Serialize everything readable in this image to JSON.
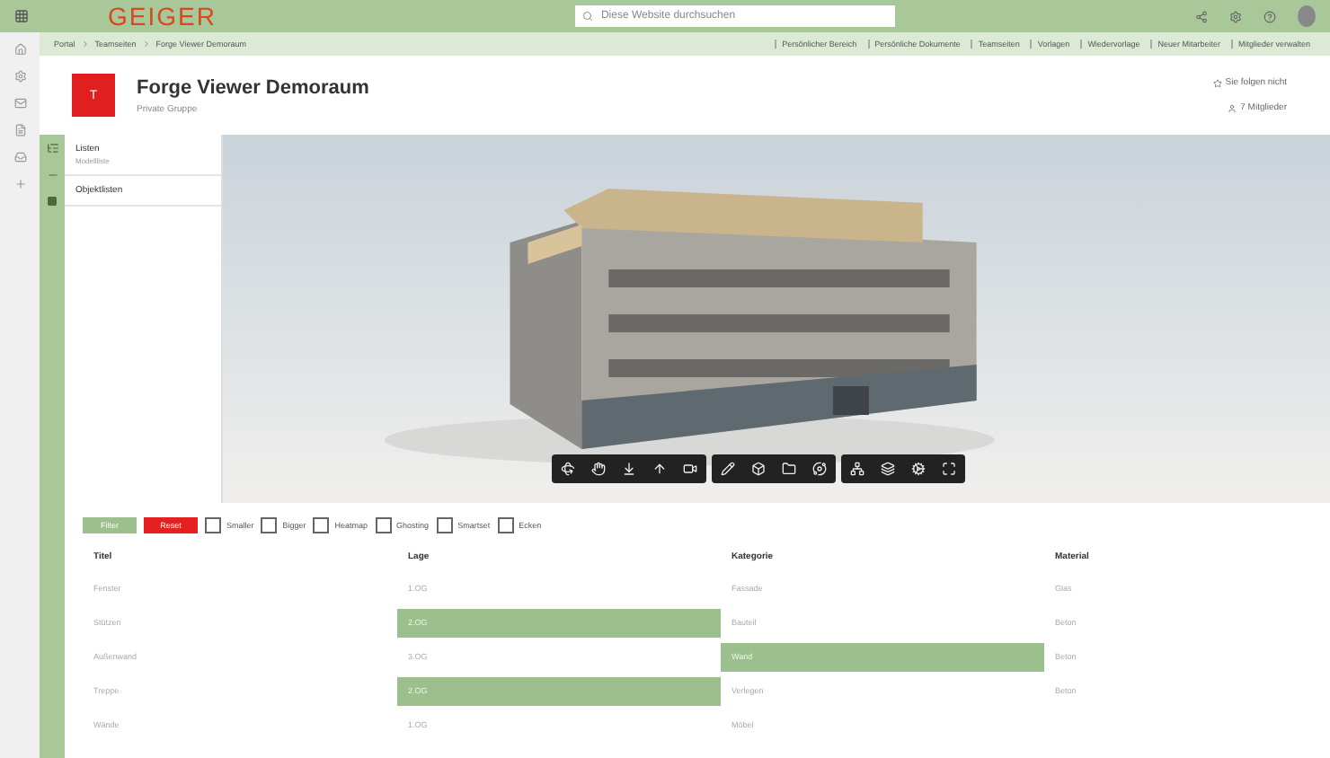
{
  "topbar": {
    "logo": "GEIGER",
    "search": {
      "placeholder": "Diese Website durchsuchen"
    }
  },
  "breadcrumb": [
    "Portal",
    "Teamseiten",
    "Forge Viewer Demoraum"
  ],
  "nav_links": [
    "Persönlicher Bereich",
    "Persönliche Dokumente",
    "Teamseiten",
    "Vorlagen",
    "Wiedervorlage",
    "Neuer Mitarbeiter",
    "Mitglieder verwalten"
  ],
  "site": {
    "badge": "T",
    "title": "Forge Viewer Demoraum",
    "subtitle": "Private Gruppe",
    "follow": "Sie folgen nicht",
    "members": "7 Mitglieder"
  },
  "side_panel": [
    {
      "label": "Listen",
      "sub": "Modellliste"
    },
    {
      "label": "Objektlisten"
    }
  ],
  "filter": {
    "buttons": [
      {
        "label": "Filter",
        "kind": "primary"
      },
      {
        "label": "Reset",
        "kind": "danger"
      }
    ],
    "options": [
      {
        "label": "Smaller",
        "checked": false
      },
      {
        "label": "Bigger",
        "checked": false
      },
      {
        "label": "Heatmap",
        "checked": false
      },
      {
        "label": "Ghosting",
        "checked": false
      },
      {
        "label": "Smartset",
        "checked": false
      },
      {
        "label": "Ecken",
        "checked": false
      }
    ]
  },
  "table": {
    "columns": [
      "Titel",
      "Lage",
      "Kategorie",
      "Material"
    ],
    "rows": [
      [
        {
          "text": "Fenster",
          "highlighted": false
        },
        {
          "text": "1.OG",
          "highlighted": false
        },
        {
          "text": "Fassade",
          "highlighted": false
        },
        {
          "text": "Glas",
          "highlighted": false
        }
      ],
      [
        {
          "text": "Stützen",
          "highlighted": false
        },
        {
          "text": "2.OG",
          "highlighted": true
        },
        {
          "text": "Bauteil",
          "highlighted": false
        },
        {
          "text": "Beton",
          "highlighted": false
        }
      ],
      [
        {
          "text": "Außenwand",
          "highlighted": false
        },
        {
          "text": "3.OG",
          "highlighted": false
        },
        {
          "text": "Wand",
          "highlighted": true
        },
        {
          "text": "Beton",
          "highlighted": false
        }
      ],
      [
        {
          "text": "Treppe",
          "highlighted": false
        },
        {
          "text": "2.OG",
          "highlighted": true
        },
        {
          "text": "Verlegen",
          "highlighted": false
        },
        {
          "text": "Beton",
          "highlighted": false
        }
      ],
      [
        {
          "text": "Wände",
          "highlighted": false
        },
        {
          "text": "1.OG",
          "highlighted": false
        },
        {
          "text": "Möbel",
          "highlighted": false
        }
      ]
    ]
  }
}
